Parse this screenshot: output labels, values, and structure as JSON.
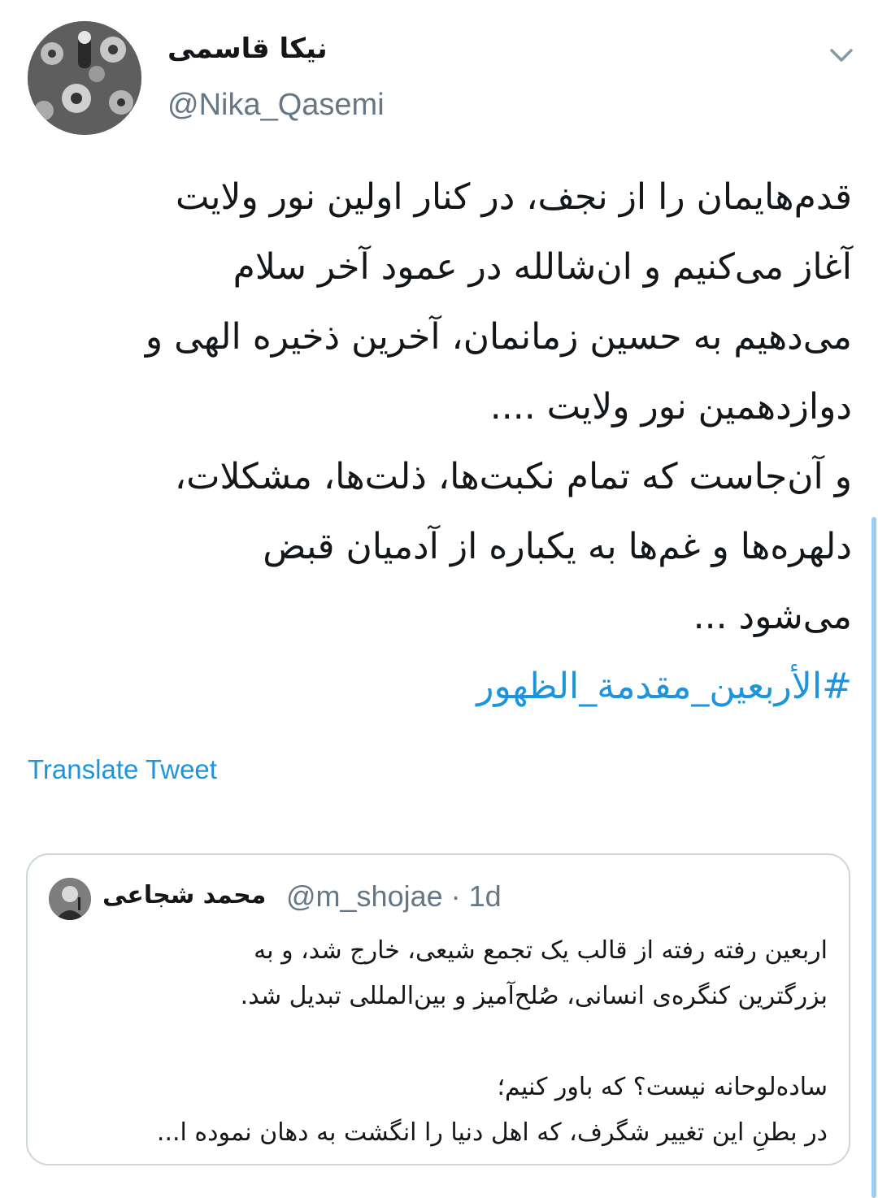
{
  "author": {
    "display_name": "نیکا قاسمی",
    "handle": "@Nika_Qasemi"
  },
  "tweet": {
    "lines": [
      "قدم‌هایمان را از نجف، در کنار اولین نور ولایت",
      "آغاز می‌کنیم و ان‌شالله در عمود آخر سلام",
      "می‌دهیم به حسین زمانمان، آخرین ذخیره الهی و",
      "دوازدهمین نور ولایت ....",
      "و آن‌جاست که تمام نکبت‌ها، ذلت‌ها، مشکلات،",
      "دلهره‌ها و غم‌ها به یکباره از آدمیان قبض",
      "می‌شود ..."
    ],
    "hashtag": "#الأربعين_مقدمة_الظهور",
    "translate_label": "Translate Tweet"
  },
  "quoted_tweet": {
    "display_name": "محمد شجاعی",
    "handle_time": "@m_shojae · 1d",
    "lines": [
      "اربعین رفته رفته از قالب یک تجمع شیعی، خارج شد، و به",
      "بزرگترین کنگره‌ی انسانی، صُلح‌آمیز و بین‌المللی تبدیل شد.",
      "",
      "ساده‌لوحانه نیست؟ که باور کنیم؛",
      "در بطنِ این تغییر شگرف، که اهل دنیا را انگشت به دهان نموده ا..."
    ]
  },
  "icons": {
    "caret": "chevron-down-icon"
  },
  "colors": {
    "link": "#1b95e0",
    "secondary_text": "#657786",
    "border": "#ccd6dd"
  }
}
